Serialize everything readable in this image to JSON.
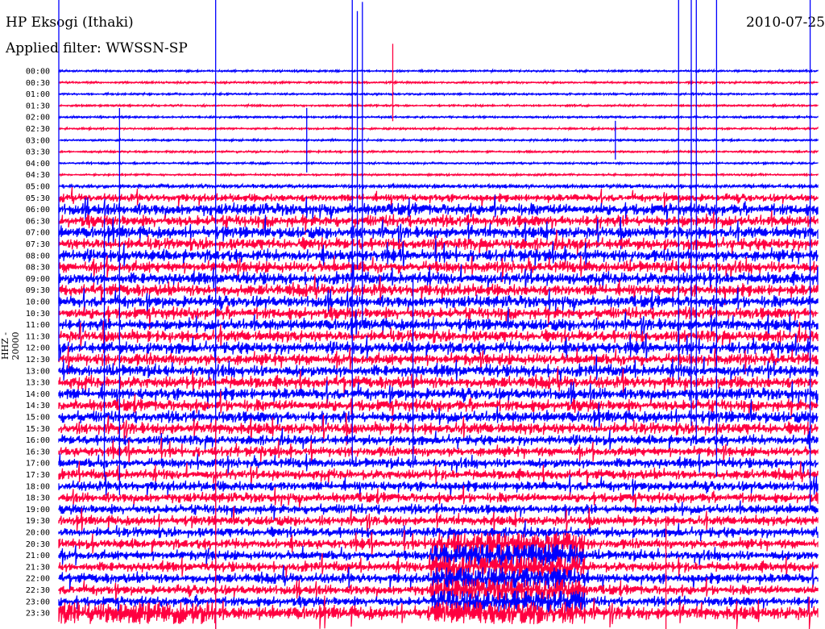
{
  "header": {
    "station": "HP Eksogi (Ithaki)",
    "filter": "Applied filter: WWSSN-SP",
    "date": "2010-07-25",
    "channel": "HHZ - 20000"
  },
  "chart_data": {
    "type": "line",
    "title": "HP Eksogi (Ithaki)",
    "subtitle": "Applied filter: WWSSN-SP",
    "ylabel": "HHZ - 20000",
    "minutes_per_row": 30,
    "colors": [
      "#0000ff",
      "#ff0040"
    ],
    "row_labels": [
      "00:00",
      "00:30",
      "01:00",
      "01:30",
      "02:00",
      "02:30",
      "03:00",
      "03:30",
      "04:00",
      "04:30",
      "05:00",
      "05:30",
      "06:00",
      "06:30",
      "07:00",
      "07:30",
      "08:00",
      "08:30",
      "09:00",
      "09:30",
      "10:00",
      "10:30",
      "11:00",
      "11:30",
      "12:00",
      "12:30",
      "13:00",
      "13:30",
      "14:00",
      "14:30",
      "15:00",
      "15:30",
      "16:00",
      "16:30",
      "17:00",
      "17:30",
      "18:00",
      "18:30",
      "19:00",
      "19:30",
      "20:00",
      "20:30",
      "21:00",
      "21:30",
      "22:00",
      "22:30",
      "23:00",
      "23:30"
    ],
    "noise_amplitude": [
      1,
      1,
      1,
      1,
      1,
      1,
      1,
      1,
      1,
      1,
      2,
      4,
      6,
      6,
      6,
      6,
      6,
      6,
      6,
      6,
      6,
      6,
      6,
      6,
      6,
      6,
      6,
      6,
      6,
      6,
      6,
      6,
      5,
      5,
      5,
      5,
      5,
      5,
      5,
      5,
      5,
      5,
      5,
      5,
      5,
      5,
      5,
      7
    ],
    "events": [
      {
        "row": 0,
        "minute": 0.0,
        "amp": 90
      },
      {
        "row": 0,
        "minute": 6.2,
        "amp": 200
      },
      {
        "row": 0,
        "minute": 11.6,
        "amp": 120
      },
      {
        "row": 0,
        "minute": 25.0,
        "amp": 110
      },
      {
        "row": 1,
        "minute": 13.2,
        "amp": 12
      },
      {
        "row": 6,
        "minute": 9.8,
        "amp": 10
      },
      {
        "row": 6,
        "minute": 11.8,
        "amp": 40
      },
      {
        "row": 6,
        "minute": 22.0,
        "amp": 6
      },
      {
        "row": 8,
        "minute": 12.0,
        "amp": 50
      },
      {
        "row": 10,
        "minute": 24.5,
        "amp": 60
      },
      {
        "row": 10,
        "minute": 25.2,
        "amp": 80
      },
      {
        "row": 10,
        "minute": 26.0,
        "amp": 90
      },
      {
        "row": 10,
        "minute": 29.7,
        "amp": 100
      },
      {
        "row": 20,
        "minute": 2.4,
        "amp": 60
      },
      {
        "row": 24,
        "minute": 1.8,
        "amp": 40
      },
      {
        "row": 26,
        "minute": 14.0,
        "amp": 30
      },
      {
        "row": 47,
        "minute": 6.2,
        "amp": 60
      },
      {
        "row": 47,
        "minute": 24.0,
        "amp": 30
      }
    ],
    "saturated_windows": [
      {
        "rows": [
          41,
          47
        ],
        "start_minute": 14.7,
        "end_minute": 20.8
      },
      {
        "rows": [
          47,
          47
        ],
        "start_minute": 0.0,
        "end_minute": 6.2
      }
    ]
  }
}
